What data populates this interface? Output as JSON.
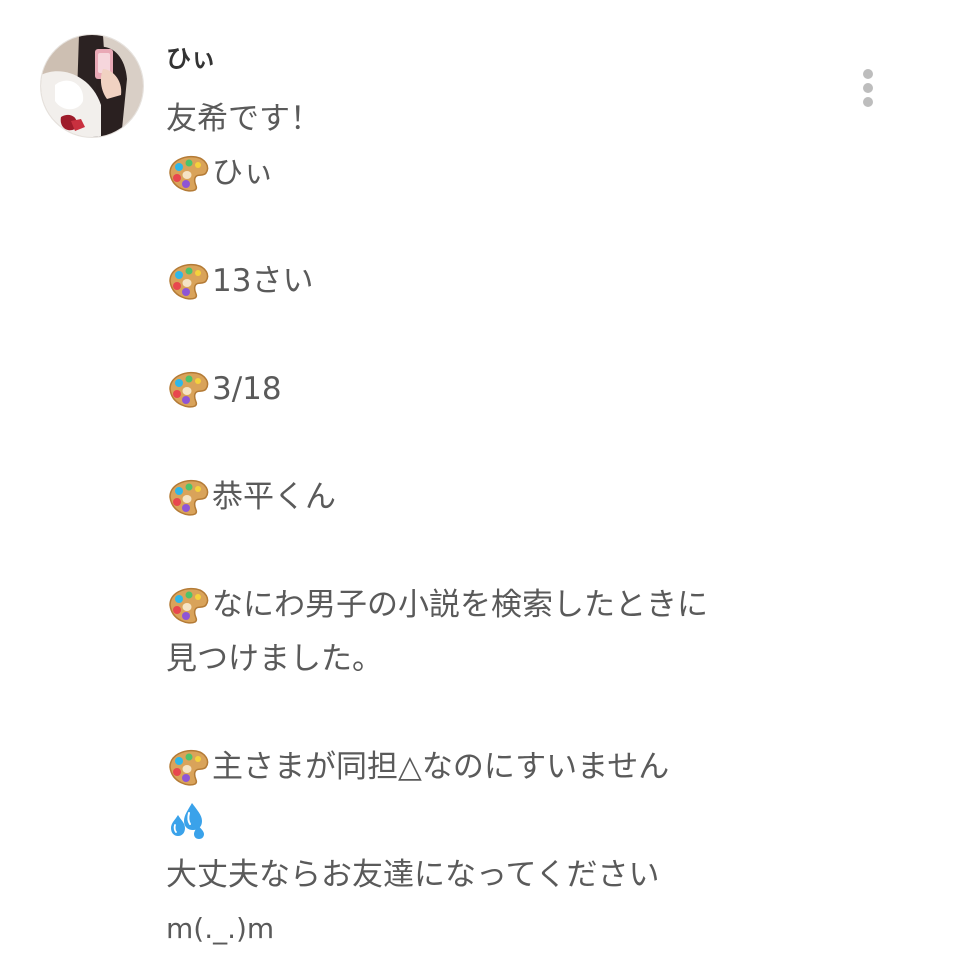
{
  "post": {
    "username": "ひぃ",
    "avatar_icon": "selfie-avatar",
    "more_icon": "vertical-ellipsis-icon",
    "lines": [
      {
        "icon": null,
        "text": "友希です！"
      },
      {
        "icon": "artist-palette-icon",
        "text": "ひぃ"
      },
      {
        "icon": null,
        "text": ""
      },
      {
        "icon": "artist-palette-icon",
        "text": "13さい"
      },
      {
        "icon": null,
        "text": ""
      },
      {
        "icon": "artist-palette-icon",
        "text": "3/18"
      },
      {
        "icon": null,
        "text": ""
      },
      {
        "icon": "artist-palette-icon",
        "text": "恭平くん"
      },
      {
        "icon": null,
        "text": ""
      },
      {
        "icon": "artist-palette-icon",
        "text": "なにわ男子の小説を検索したときに"
      },
      {
        "icon": null,
        "text": "見つけました。"
      },
      {
        "icon": null,
        "text": ""
      },
      {
        "icon": "artist-palette-icon",
        "text": "主さまが同担△なのにすいません"
      },
      {
        "icon": "sweat-droplets-icon",
        "text": ""
      },
      {
        "icon": null,
        "text": "大丈夫ならお友達になってください"
      },
      {
        "icon": null,
        "text": "m(._.)m"
      }
    ]
  }
}
